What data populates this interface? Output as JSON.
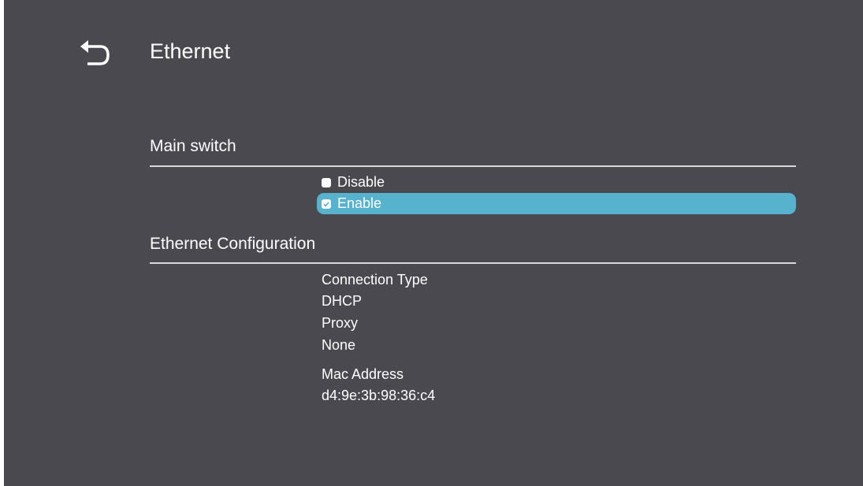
{
  "header": {
    "title": "Ethernet",
    "back_icon": "back-arrow-icon"
  },
  "main_switch": {
    "title": "Main switch",
    "options": [
      {
        "label": "Disable",
        "checked": false
      },
      {
        "label": "Enable",
        "checked": true
      }
    ],
    "selected_color": "#56b2cd"
  },
  "ethernet_config": {
    "title": "Ethernet Configuration",
    "connection_type_label": "Connection Type",
    "connection_type_value": "DHCP",
    "proxy_label": "Proxy",
    "proxy_value": "None",
    "mac_label": "Mac Address",
    "mac_value": "d4:9e:3b:98:36:c4"
  },
  "colors": {
    "background": "#4a4950",
    "accent": "#56b2cd",
    "text": "#ffffff"
  }
}
